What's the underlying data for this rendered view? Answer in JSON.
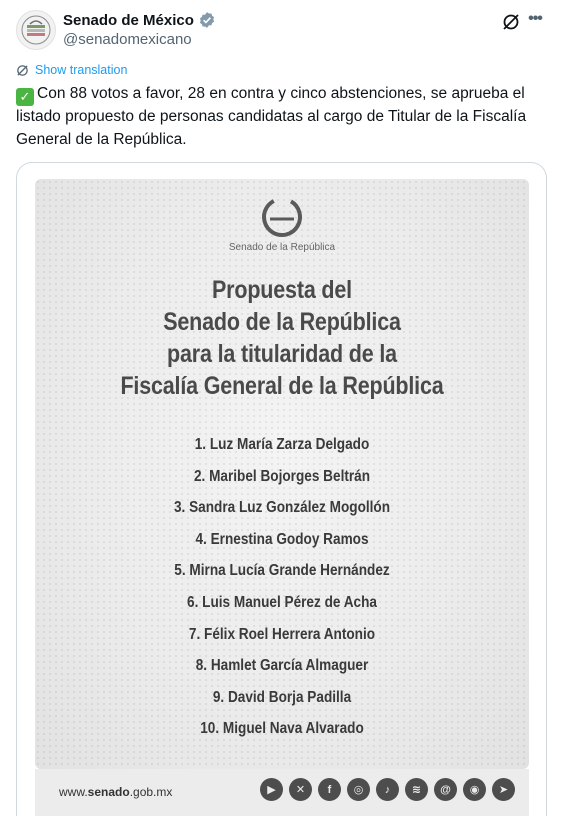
{
  "account": {
    "display_name": "Senado de México",
    "handle": "@senadomexicano",
    "verified_color": "#829aab"
  },
  "translate": {
    "label": "Show translation"
  },
  "tweet": {
    "emoji": "✅",
    "text": "Con 88 votos a favor, 28 en contra y cinco abstenciones, se aprueba el listado propuesto de personas candidatas al cargo de Titular de la Fiscalía General de la República."
  },
  "poster": {
    "logo_caption": "Senado de la República",
    "title_lines": [
      "Propuesta del",
      "Senado de la República",
      "para la titularidad de la",
      "Fiscalía General de la República"
    ],
    "candidates": [
      "1. Luz María Zarza Delgado",
      "2. Maribel Bojorges Beltrán",
      "3. Sandra Luz González Mogollón",
      "4. Ernestina Godoy Ramos",
      "5. Mirna Lucía Grande Hernández",
      "6. Luis Manuel Pérez de Acha",
      "7. Félix Roel Herrera Antonio",
      "8. Hamlet García Almaguer",
      "9. David Borja Padilla",
      "10. Miguel Nava Alvarado"
    ],
    "site_prefix": "www.",
    "site_bold": "senado",
    "site_suffix": ".gob.mx",
    "social_icons": [
      "youtube-icon",
      "x-icon",
      "facebook-icon",
      "instagram-icon",
      "tiktok-icon",
      "spotify-icon",
      "threads-icon",
      "podcast-icon",
      "telegram-icon"
    ]
  },
  "colors": {
    "link_blue": "#1d9bf0",
    "muted": "#536471",
    "text": "#0f1419"
  }
}
